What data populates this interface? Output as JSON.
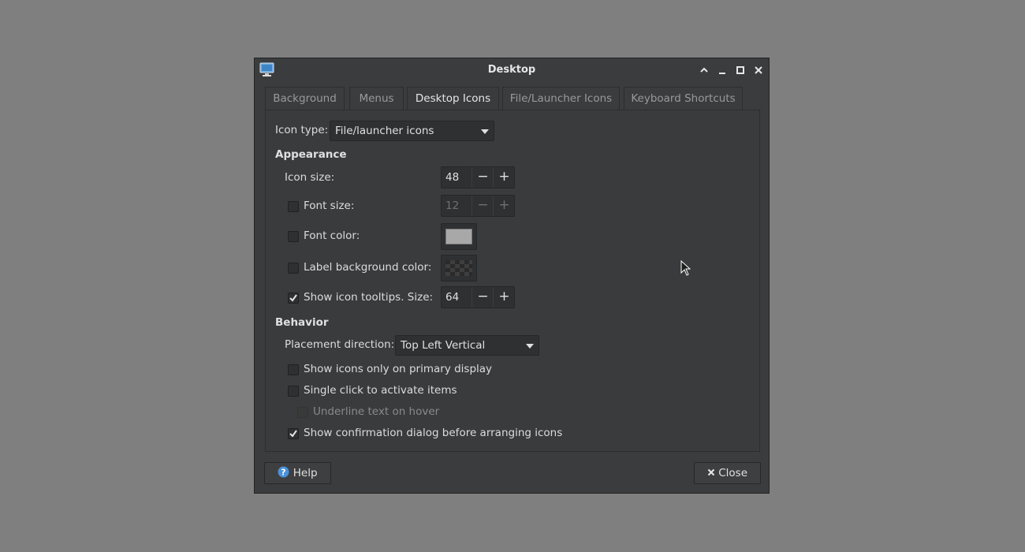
{
  "window": {
    "title": "Desktop"
  },
  "tabs": [
    {
      "label": "Background"
    },
    {
      "label": "Menus"
    },
    {
      "label": "Desktop Icons"
    },
    {
      "label": "File/Launcher Icons"
    },
    {
      "label": "Keyboard Shortcuts"
    }
  ],
  "icon_type": {
    "label": "Icon type:",
    "value": "File/launcher icons"
  },
  "appearance": {
    "heading": "Appearance",
    "icon_size": {
      "label": "Icon size:",
      "value": "48"
    },
    "font_size": {
      "label": "Font size:",
      "value": "12",
      "checked": false
    },
    "font_color": {
      "label": "Font color:",
      "checked": false,
      "swatch": "#a8a8a8"
    },
    "label_bg": {
      "label": "Label background color:",
      "checked": false
    },
    "tooltips": {
      "label": "Show icon tooltips. Size:",
      "value": "64",
      "checked": true
    }
  },
  "behavior": {
    "heading": "Behavior",
    "placement": {
      "label": "Placement direction:",
      "value": "Top Left Vertical"
    },
    "primary_only": {
      "label": "Show icons only on primary display",
      "checked": false
    },
    "single_click": {
      "label": "Single click to activate items",
      "checked": false
    },
    "underline": {
      "label": "Underline text on hover",
      "checked": false
    },
    "confirm_arrange": {
      "label": "Show confirmation dialog before arranging icons",
      "checked": true
    }
  },
  "buttons": {
    "help": "Help",
    "close": "Close"
  },
  "spin": {
    "minus": "−",
    "plus": "+"
  }
}
